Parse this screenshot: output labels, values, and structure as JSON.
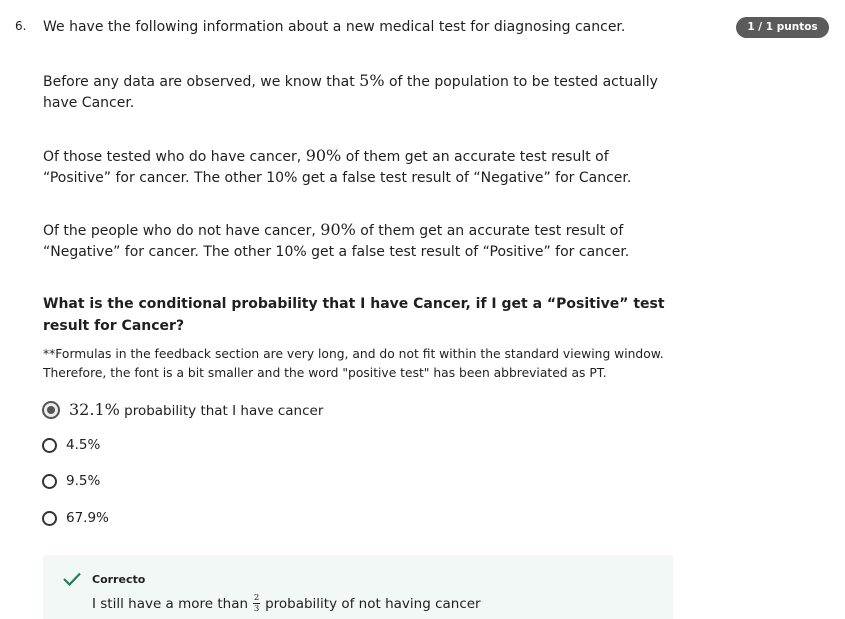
{
  "question": {
    "number": "6.",
    "score": "1 / 1 puntos",
    "intro": "We have the following information about a new medical test for diagnosing cancer.",
    "p1": {
      "before": "Before any data are observed, we know that ",
      "math": "5%",
      "after": " of the population to be tested actually have Cancer."
    },
    "p2": {
      "before": "Of those tested who do have cancer, ",
      "math": "90%",
      "after": " of them get an accurate test result of “Positive” for cancer. The other 10% get a false test result of “Negative” for Cancer."
    },
    "p3": {
      "before": "Of the people who do not have cancer, ",
      "math": "90%",
      "after": " of them get an accurate test result of “Negative” for cancer. The other 10% get a false test result of “Positive” for cancer."
    },
    "prompt": "What is the conditional probability that I have Cancer, if I get a “Positive” test result for Cancer?",
    "note": "**Formulas in the feedback section are very long, and do not fit within the standard viewing window. Therefore, the font is a bit smaller and the word \"positive test\" has been abbreviated as PT."
  },
  "options": [
    {
      "math": "32.1%",
      "text": " probability that I have cancer",
      "selected": true
    },
    {
      "math": "",
      "text": "4.5%",
      "selected": false
    },
    {
      "math": "",
      "text": "9.5%",
      "selected": false
    },
    {
      "math": "",
      "text": "67.9%",
      "selected": false
    }
  ],
  "feedback": {
    "status": "Correcto",
    "text_before": "I still have a more than ",
    "frac_num": "2",
    "frac_den": "3",
    "text_after": " probability of not having cancer"
  },
  "colors": {
    "badge": "#5b5b5b",
    "feedback_bg": "#f2f8f5",
    "check": "#1f8354"
  }
}
